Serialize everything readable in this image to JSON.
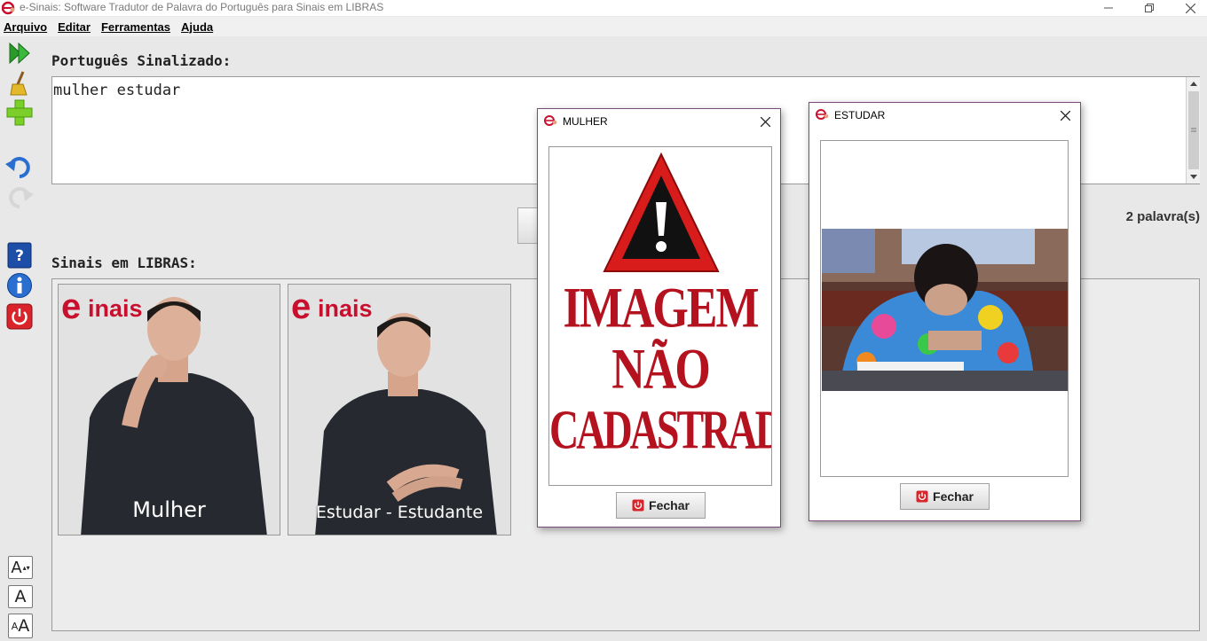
{
  "window": {
    "title": "e-Sinais: Software Tradutor de Palavra do Português para Sinais em LIBRAS",
    "controls": [
      "minimize",
      "restore",
      "close"
    ]
  },
  "menu": [
    {
      "label": "Arquivo"
    },
    {
      "label": "Editar"
    },
    {
      "label": "Ferramentas"
    },
    {
      "label": "Ajuda"
    }
  ],
  "toolbar": {
    "icons": [
      "play-icon",
      "broom-icon",
      "plus-icon",
      "undo-icon",
      "redo-icon",
      "help-icon",
      "info-icon",
      "power-icon"
    ]
  },
  "portugues": {
    "label": "Português Sinalizado:",
    "text": "mulher estudar",
    "word_count": "2 palavra(s)"
  },
  "libras": {
    "label": "Sinais em LIBRAS:",
    "logo_text": "inais",
    "cards": [
      {
        "caption": "Mulher"
      },
      {
        "caption": "Estudar - Estudante"
      }
    ]
  },
  "font_controls": [
    "A",
    "A",
    "A"
  ],
  "dialogs": [
    {
      "title": "MULHER",
      "image_lines": [
        "IMAGEM",
        "NÃO",
        "CADASTRADA"
      ],
      "button": "Fechar"
    },
    {
      "title": "ESTUDAR",
      "button": "Fechar"
    }
  ],
  "colors": {
    "accent_red": "#c8102e",
    "background": "#e8e8e8",
    "dialog_border": "#7a4a7a"
  }
}
